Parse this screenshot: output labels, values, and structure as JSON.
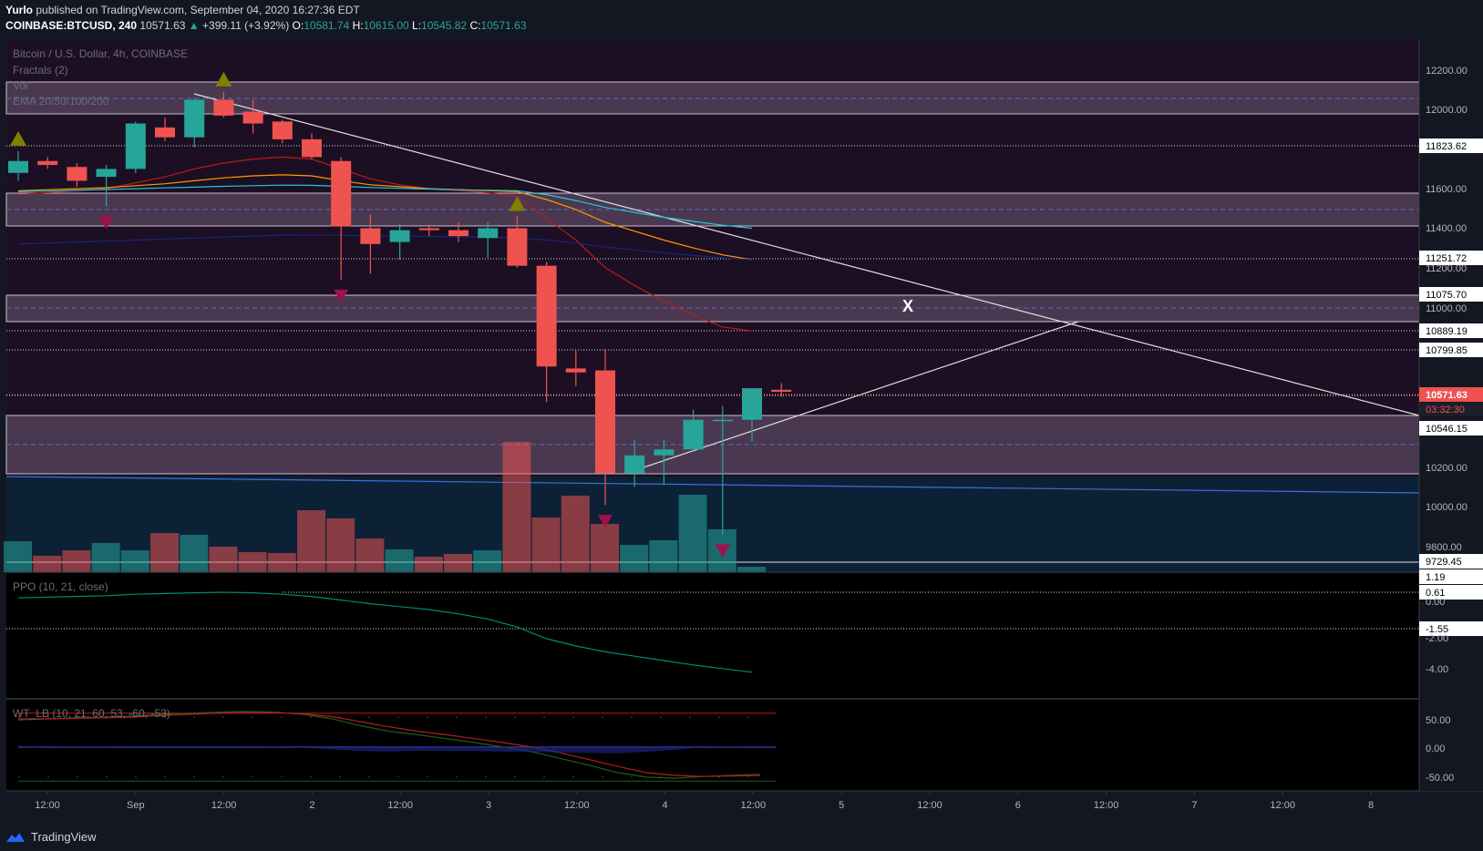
{
  "header": {
    "author": "Yurlo",
    "published_text": "published on TradingView.com, September 04, 2020 16:27:36 EDT",
    "symbol": "COINBASE:BTCUSD, 240",
    "last": "10571.63",
    "change_arrow": "▲",
    "change": "+399.11 (+3.92%)",
    "o_label": "O:",
    "o": "10581.74",
    "h_label": "H:",
    "h": "10615.00",
    "l_label": "L:",
    "l": "10545.82",
    "c_label": "C:",
    "c": "10571.63"
  },
  "legend": {
    "title": "Bitcoin / U.S. Dollar, 4h, COINBASE",
    "fractals": "Fractals (2)",
    "vol": "Vol",
    "ema": "EMA 20/50/100/200",
    "ppo": "PPO (10, 21, close)",
    "wt": "WT_LB (10, 21, 60, 53, -60, -53)"
  },
  "annotation": "X",
  "brand": "TradingView",
  "colors": {
    "up": "#26a69a",
    "down": "#ef5350",
    "zone": "#4a3850",
    "chart_bg": "#1c0f23",
    "volume_bg": "#0d2136"
  },
  "chart_data": [
    {
      "type": "candlestick",
      "title": "Bitcoin / U.S. Dollar, 4h, COINBASE",
      "x_ticks": [
        "12:00",
        "Sep",
        "12:00",
        "2",
        "12:00",
        "3",
        "12:00",
        "4",
        "12:00",
        "5",
        "12:00",
        "6",
        "12:00",
        "7",
        "12:00",
        "8"
      ],
      "y_ticks": [
        "12200.00",
        "12000.00",
        "11823.62",
        "11600.00",
        "11400.00",
        "11251.72",
        "11200.00",
        "11075.70",
        "11000.00",
        "10889.19",
        "10799.85",
        "10571.63",
        "10546.15",
        "10200.00",
        "10000.00",
        "9800.00",
        "9729.45"
      ],
      "price_tag": "10571.63",
      "countdown": "03:32:30",
      "ylim": [
        9690,
        12300
      ],
      "candles": [
        {
          "o": 11680,
          "h": 11790,
          "l": 11640,
          "c": 11740
        },
        {
          "o": 11740,
          "h": 11760,
          "l": 11700,
          "c": 11720
        },
        {
          "o": 11710,
          "h": 11730,
          "l": 11610,
          "c": 11640
        },
        {
          "o": 11660,
          "h": 11720,
          "l": 11510,
          "c": 11700
        },
        {
          "o": 11700,
          "h": 11940,
          "l": 11680,
          "c": 11930
        },
        {
          "o": 11910,
          "h": 11960,
          "l": 11840,
          "c": 11860
        },
        {
          "o": 11860,
          "h": 12060,
          "l": 11810,
          "c": 12050
        },
        {
          "o": 12050,
          "h": 12090,
          "l": 11960,
          "c": 11970
        },
        {
          "o": 11990,
          "h": 12050,
          "l": 11880,
          "c": 11930
        },
        {
          "o": 11940,
          "h": 11950,
          "l": 11830,
          "c": 11850
        },
        {
          "o": 11850,
          "h": 11880,
          "l": 11750,
          "c": 11760
        },
        {
          "o": 11740,
          "h": 11760,
          "l": 11140,
          "c": 11410
        },
        {
          "o": 11400,
          "h": 11470,
          "l": 11170,
          "c": 11320
        },
        {
          "o": 11330,
          "h": 11420,
          "l": 11240,
          "c": 11390
        },
        {
          "o": 11400,
          "h": 11420,
          "l": 11360,
          "c": 11390
        },
        {
          "o": 11390,
          "h": 11430,
          "l": 11330,
          "c": 11360
        },
        {
          "o": 11350,
          "h": 11430,
          "l": 11250,
          "c": 11400
        },
        {
          "o": 11400,
          "h": 11460,
          "l": 11200,
          "c": 11210
        },
        {
          "o": 11210,
          "h": 11230,
          "l": 10520,
          "c": 10700
        },
        {
          "o": 10690,
          "h": 10780,
          "l": 10600,
          "c": 10670
        },
        {
          "o": 10680,
          "h": 10790,
          "l": 10000,
          "c": 10160
        },
        {
          "o": 10160,
          "h": 10330,
          "l": 10090,
          "c": 10250
        },
        {
          "o": 10250,
          "h": 10330,
          "l": 10100,
          "c": 10280
        },
        {
          "o": 10280,
          "h": 10480,
          "l": 10280,
          "c": 10430
        },
        {
          "o": 10430,
          "h": 10500,
          "l": 9850,
          "c": 10430
        },
        {
          "o": 10430,
          "h": 10590,
          "l": 10320,
          "c": 10590
        },
        {
          "o": 10582,
          "h": 10615,
          "l": 10546,
          "c": 10572
        }
      ],
      "emas": [
        {
          "name": "EMA 20",
          "color": "#b71c1c",
          "values": [
            11570,
            11580,
            11590,
            11600,
            11630,
            11660,
            11700,
            11730,
            11750,
            11760,
            11750,
            11700,
            11650,
            11620,
            11600,
            11590,
            11580,
            11560,
            11450,
            11340,
            11200,
            11110,
            11030,
            10960,
            10900,
            10880
          ]
        },
        {
          "name": "EMA 50",
          "color": "#ff9800",
          "values": [
            11590,
            11595,
            11600,
            11605,
            11615,
            11625,
            11640,
            11655,
            11665,
            11670,
            11665,
            11640,
            11620,
            11610,
            11600,
            11595,
            11590,
            11585,
            11545,
            11495,
            11430,
            11385,
            11340,
            11300,
            11265,
            11240
          ]
        },
        {
          "name": "EMA 100",
          "color": "#26c6da",
          "values": [
            11585,
            11588,
            11592,
            11596,
            11600,
            11604,
            11608,
            11612,
            11615,
            11618,
            11617,
            11612,
            11606,
            11602,
            11598,
            11595,
            11592,
            11590,
            11570,
            11540,
            11505,
            11480,
            11455,
            11435,
            11415,
            11400
          ]
        },
        {
          "name": "EMA 200",
          "color": "#1a237e",
          "values": [
            11320,
            11325,
            11330,
            11335,
            11340,
            11345,
            11350,
            11355,
            11360,
            11365,
            11366,
            11364,
            11362,
            11360,
            11358,
            11356,
            11354,
            11352,
            11340,
            11325,
            11305,
            11290,
            11275,
            11262,
            11250,
            11240
          ]
        }
      ],
      "fractals_up": [
        0,
        7,
        17
      ],
      "fractals_down": [
        3,
        11,
        20,
        24
      ]
    },
    {
      "type": "bar",
      "title": "Vol",
      "values": [
        34,
        18,
        24,
        32,
        24,
        43,
        41,
        28,
        22,
        21,
        68,
        59,
        37,
        25,
        17,
        20,
        24,
        143,
        60,
        84,
        53,
        30,
        35,
        85,
        47,
        6
      ]
    },
    {
      "type": "line",
      "title": "PPO (10, 21, close)",
      "y_ticks": [
        "1.19",
        "0.61",
        "0.00",
        "-1.55",
        "-2.00",
        "-4.00"
      ],
      "ylim": [
        -5.3,
        1.7
      ],
      "values": [
        0.8,
        0.85,
        0.9,
        0.95,
        1.05,
        1.1,
        1.15,
        1.19,
        1.15,
        1.05,
        0.9,
        0.65,
        0.4,
        0.2,
        0.0,
        -0.3,
        -0.65,
        -1.2,
        -2.0,
        -2.5,
        -2.9,
        -3.2,
        -3.5,
        -3.8,
        -4.05,
        -4.3
      ],
      "series_color": "#00897b"
    },
    {
      "type": "line",
      "title": "WT_LB (10, 21, 60, 53, -60, -53)",
      "y_ticks": [
        "50.00",
        "0.00",
        "-50.00"
      ],
      "ylim": [
        -75,
        75
      ],
      "series": [
        {
          "name": "WT1",
          "color": "#1b5e20",
          "values": [
            48,
            50,
            52,
            53,
            55,
            58,
            60,
            62,
            63,
            62,
            58,
            50,
            38,
            28,
            22,
            15,
            8,
            0,
            -8,
            -20,
            -32,
            -45,
            -53,
            -55,
            -52,
            -50,
            -48
          ]
        },
        {
          "name": "WT2",
          "color": "#b71c1c",
          "values": [
            50,
            50,
            51,
            52,
            53,
            56,
            58,
            60,
            61,
            61,
            59,
            54,
            45,
            36,
            28,
            22,
            15,
            8,
            0,
            -10,
            -22,
            -34,
            -45,
            -50,
            -52,
            -51,
            -50
          ]
        },
        {
          "name": "Diff",
          "color": "#1a237e",
          "values": [
            -2,
            0,
            1,
            1,
            2,
            2,
            2,
            2,
            2,
            1,
            -1,
            -4,
            -7,
            -8,
            -6,
            -7,
            -7,
            -8,
            -8,
            -10,
            -10,
            -11,
            -8,
            -5,
            0,
            1,
            2
          ]
        }
      ],
      "levels": [
        53,
        60,
        -53,
        -60
      ]
    }
  ]
}
